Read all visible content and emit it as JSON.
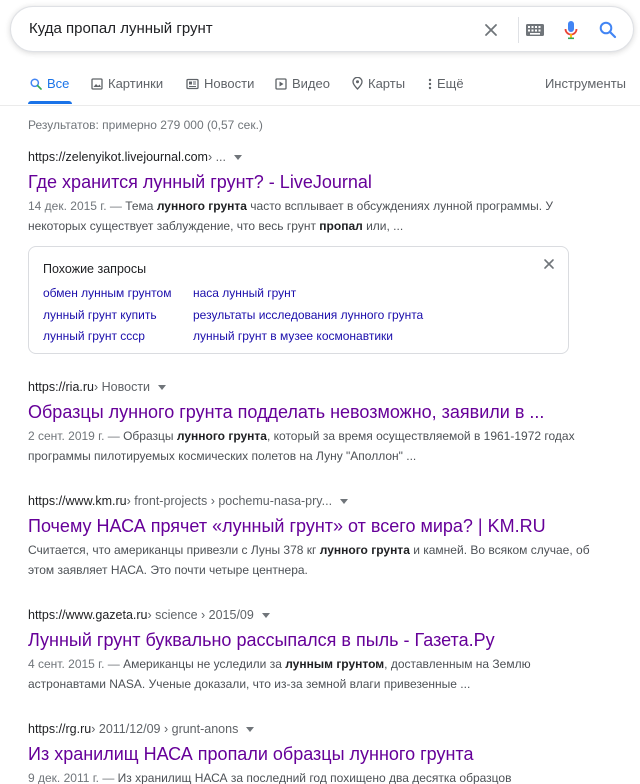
{
  "search": {
    "query": "Куда пропал лунный грунт"
  },
  "tabs": [
    {
      "label": "Все",
      "icon": "search-icon",
      "active": true
    },
    {
      "label": "Картинки",
      "icon": "image-icon"
    },
    {
      "label": "Новости",
      "icon": "news-icon"
    },
    {
      "label": "Видео",
      "icon": "play-icon"
    },
    {
      "label": "Карты",
      "icon": "map-pin-icon"
    },
    {
      "label": "Ещё",
      "icon": "more-vert-icon"
    }
  ],
  "tools_label": "Инструменты",
  "result_stats": "Результатов: примерно 279 000 (0,57 сек.)",
  "results": [
    {
      "domain": "https://zelenyikot.livejournal.com",
      "path": " › ...",
      "title": "Где хранится лунный грунт? - LiveJournal",
      "date": "14 дек. 2015 г. — ",
      "snippet_html": "Тема <b>лунного грунта</b> часто всплывает в обсуждениях лунной программы. У некоторых существует заблуждение, что весь грунт <b>пропал</b> или, ..."
    },
    {
      "domain": "https://ria.ru",
      "path": " › Новости",
      "title": "Образцы лунного грунта подделать невозможно, заявили в ...",
      "date": "2 сент. 2019 г. — ",
      "snippet_html": "Образцы <b>лунного грунта</b>, который за время осуществляемой в 1961-1972 годах программы пилотируемых космических полетов на Луну \"Аполлон\" ..."
    },
    {
      "domain": "https://www.km.ru",
      "path": " › front-projects › pochemu-nasa-pry...",
      "title": "Почему НАСА прячет «лунный грунт» от всего мира? | KM.RU",
      "date": "",
      "snippet_html": "Считается, что американцы привезли с Луны 378 кг <b>лунного грунта</b> и камней. Во всяком случае, об этом заявляет НАСА. Это почти четыре центнера."
    },
    {
      "domain": "https://www.gazeta.ru",
      "path": " › science › 2015/09",
      "title": "Лунный грунт буквально рассыпался в пыль - Газета.Ру",
      "date": "4 сент. 2015 г. — ",
      "snippet_html": "Американцы не уследили за <b>лунным грунтом</b>, доставленным на Землю астронавтами NASA. Ученые доказали, что из-за земной влаги привезенные ..."
    },
    {
      "domain": "https://rg.ru",
      "path": " › 2011/12/09 › grunt-anons",
      "title": "Из хранилищ НАСА пропали образцы лунного грунта",
      "date": "9 дек. 2011 г. — ",
      "snippet_html": "Из хранилищ НАСА за последний год похищено два десятка образцов"
    }
  ],
  "related": {
    "title": "Похожие запросы",
    "links": [
      "обмен лунным грунтом",
      "наса лунный грунт",
      "лунный грунт купить",
      "результаты исследования лунного грунта",
      "лунный грунт ссср",
      "лунный грунт в музее космонавтики"
    ]
  }
}
